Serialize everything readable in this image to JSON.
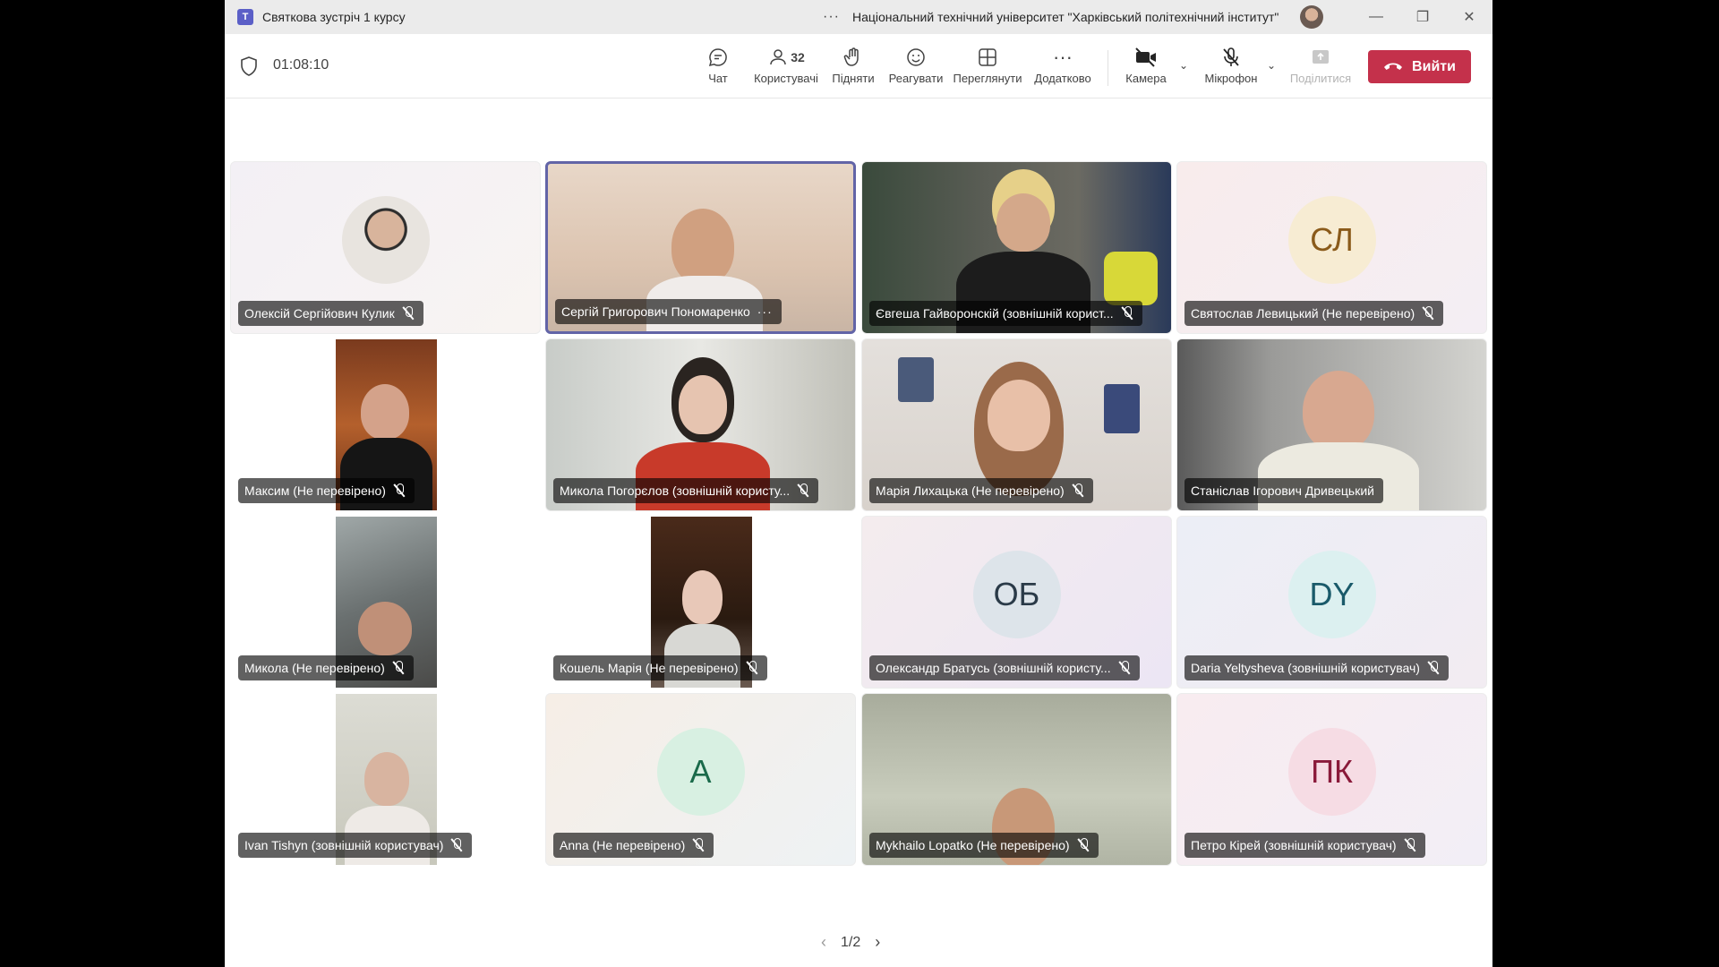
{
  "window": {
    "title": "Святкова зустріч 1 курсу",
    "org": "Національний технічний університет \"Харківський політехнічний інститут\"",
    "app_icon": "teams-icon"
  },
  "toolbar": {
    "timer": "01:08:10",
    "chat": "Чат",
    "people": "Користувачі",
    "people_count": "32",
    "raise": "Підняти",
    "react": "Реагувати",
    "view": "Переглянути",
    "more": "Додатково",
    "camera": "Камера",
    "mic": "Мікрофон",
    "share": "Поділитися",
    "leave": "Вийти"
  },
  "participants": [
    {
      "name": "Олексій Сергійович Кулик",
      "type": "photo-avatar",
      "muted": true
    },
    {
      "name": "Сергій Григорович Пономаренко",
      "type": "video",
      "active": true,
      "muted": false
    },
    {
      "name": "Євгеша Гайворонскій (зовнішній корист...",
      "type": "video",
      "muted": true
    },
    {
      "name": "Святослав Левицький (Не перевірено)",
      "type": "initials",
      "initials": "СЛ",
      "muted": true
    },
    {
      "name": "Максим (Не перевірено)",
      "type": "video",
      "muted": true
    },
    {
      "name": "Микола Погорєлов (зовнішній користу...",
      "type": "video",
      "muted": true
    },
    {
      "name": "Марія Лихацька (Не перевірено)",
      "type": "video",
      "muted": true
    },
    {
      "name": "Станіслав Ігорович Дривецький",
      "type": "video",
      "muted": false
    },
    {
      "name": "Микола (Не перевірено)",
      "type": "video",
      "muted": true
    },
    {
      "name": "Кошель Марія (Не перевірено)",
      "type": "video",
      "muted": true
    },
    {
      "name": "Олександр Братусь (зовнішній користу...",
      "type": "initials",
      "initials": "ОБ",
      "muted": true
    },
    {
      "name": "Daria Yeltysheva (зовнішній користувач)",
      "type": "initials",
      "initials": "DY",
      "muted": true
    },
    {
      "name": "Ivan Tishyn (зовнішній користувач)",
      "type": "video",
      "muted": true
    },
    {
      "name": "Anna (Не перевірено)",
      "type": "initials",
      "initials": "A",
      "muted": true
    },
    {
      "name": "Mykhailo Lopatko (Не перевірено)",
      "type": "video",
      "muted": true
    },
    {
      "name": "Петро Кірей (зовнішній користувач)",
      "type": "initials",
      "initials": "ПК",
      "muted": true
    }
  ],
  "pager": {
    "label": "1/2"
  },
  "colors": {
    "accent": "#6264a7",
    "leave": "#c4314b"
  }
}
